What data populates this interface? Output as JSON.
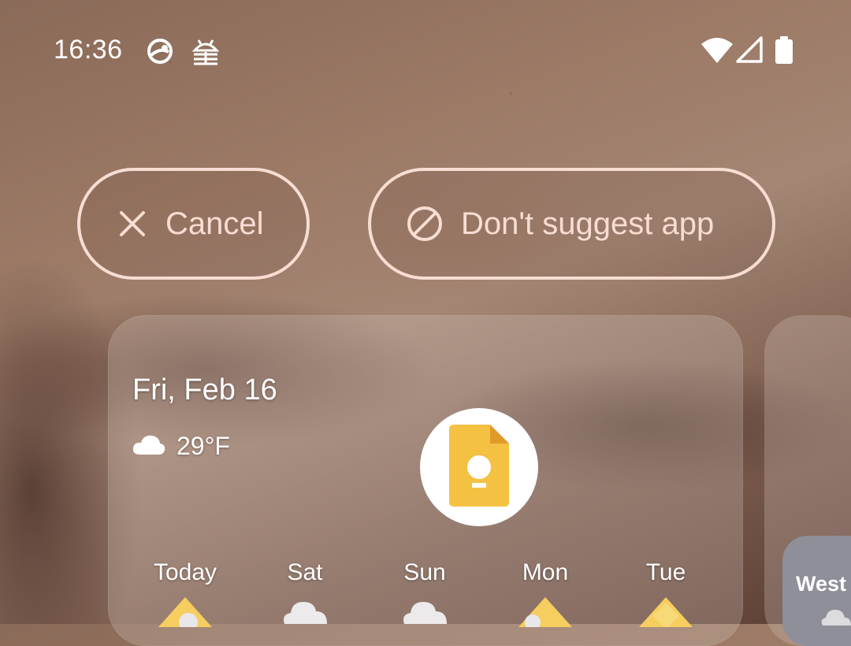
{
  "status_bar": {
    "time": "16:36",
    "left_icons": [
      "sync-profile-icon",
      "android-debug-icon"
    ],
    "right_icons": [
      "wifi-icon",
      "cell-signal-icon",
      "battery-icon"
    ]
  },
  "actions": {
    "cancel_label": "Cancel",
    "cancel_icon": "close-icon",
    "dont_suggest_label": "Don't suggest app",
    "dont_suggest_icon": "block-icon"
  },
  "weather": {
    "date": "Fri, Feb 16",
    "temperature": "29°F",
    "condition_icon": "cloud-icon",
    "forecast": [
      {
        "day": "Today",
        "icon": "partly-sunny-icon"
      },
      {
        "day": "Sat",
        "icon": "cloud-icon"
      },
      {
        "day": "Sun",
        "icon": "cloud-icon"
      },
      {
        "day": "Mon",
        "icon": "partly-sunny-icon"
      },
      {
        "day": "Tue",
        "icon": "sunny-icon"
      }
    ]
  },
  "app": {
    "icon": "google-keep-icon"
  },
  "location": {
    "label": "West S"
  },
  "colors": {
    "chip_accent": "#f7ddd2",
    "keep_yellow": "#f4c142",
    "location_card": "#8e8f98"
  }
}
